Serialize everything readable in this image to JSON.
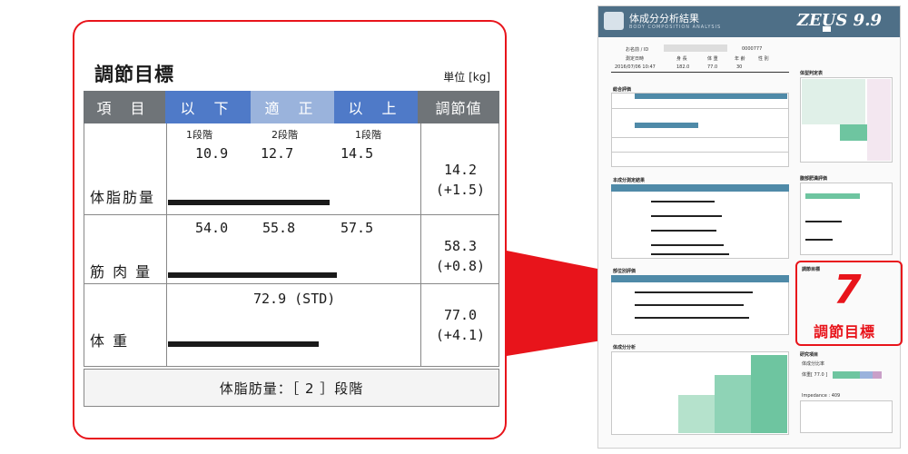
{
  "zoom": {
    "title": "調節目標",
    "unit": "単位 [kg]",
    "headers": {
      "item": "項 目",
      "low": "以 下",
      "ok": "適 正",
      "high": "以 上",
      "adjust": "調節値"
    },
    "stages": {
      "low": "1段階",
      "ok": "2段階",
      "high": "1段階"
    },
    "rows": [
      {
        "label": "体脂肪量",
        "low": "10.9",
        "ok": "12.7",
        "high": "14.5",
        "adj": "14.2",
        "adj_diff": "(+1.5)"
      },
      {
        "label": "筋 肉 量",
        "low": "54.0",
        "ok": "55.8",
        "high": "57.5",
        "adj": "58.3",
        "adj_diff": "(+0.8)"
      },
      {
        "label": "体 重",
        "std": "72.9 (STD)",
        "adj": "77.0",
        "adj_diff": "(+4.1)"
      }
    ],
    "footer": "体脂肪量：［ 2 ］段階"
  },
  "report": {
    "title": "体成分分析結果",
    "subtitle": "BODY COMPOSITION ANALYSIS",
    "brand": "ZEUS 9.9",
    "name_label": "お名前 / ID",
    "id": "0000777",
    "date_label": "測定日時",
    "datetime": "2016/07/06 10:47",
    "height_label": "身 長",
    "height": "182.0",
    "weight_label": "体 重",
    "weight": "77.0",
    "age_label": "年 齢",
    "age": "30",
    "sex_label": "性 別",
    "sec_overall": "総合評価",
    "sec_body": "体型判定表",
    "sec_result": "本成分測定結果",
    "sec_obesity": "腹部肥満評価",
    "sec_segment": "部位別評価",
    "sec_target": "調節目標",
    "sec_analysis": "体成分分析",
    "sec_research": "研究項目",
    "ratio_label": "体成分比率",
    "ratio_value": "体重[ 77.0 ]",
    "impedance": "Impedance : 409"
  },
  "callout": {
    "number": "7",
    "label": "調節目標"
  },
  "colors": {
    "accent": "#e8141b",
    "header_blue": "#4f7ac8",
    "header_gray": "#6f7478",
    "report_head": "#4e6f87"
  }
}
